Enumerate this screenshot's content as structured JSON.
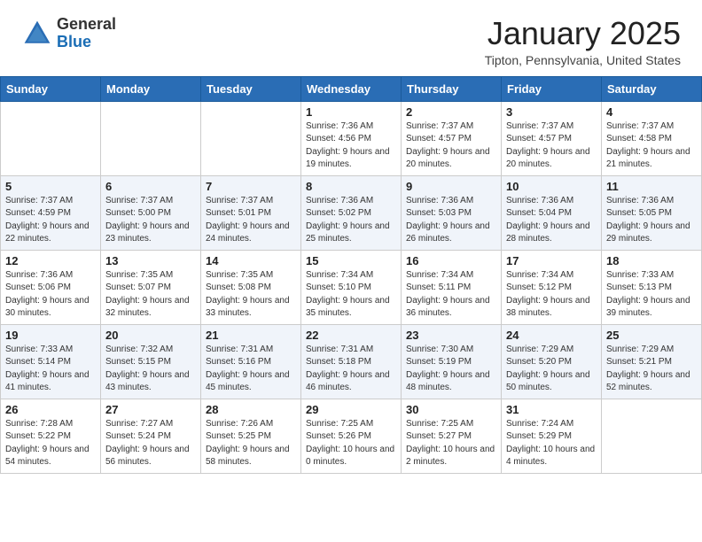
{
  "header": {
    "logo_general": "General",
    "logo_blue": "Blue",
    "month_title": "January 2025",
    "location": "Tipton, Pennsylvania, United States"
  },
  "days_of_week": [
    "Sunday",
    "Monday",
    "Tuesday",
    "Wednesday",
    "Thursday",
    "Friday",
    "Saturday"
  ],
  "weeks": [
    [
      {
        "day": "",
        "sunrise": "",
        "sunset": "",
        "daylight": ""
      },
      {
        "day": "",
        "sunrise": "",
        "sunset": "",
        "daylight": ""
      },
      {
        "day": "",
        "sunrise": "",
        "sunset": "",
        "daylight": ""
      },
      {
        "day": "1",
        "sunrise": "Sunrise: 7:36 AM",
        "sunset": "Sunset: 4:56 PM",
        "daylight": "Daylight: 9 hours and 19 minutes."
      },
      {
        "day": "2",
        "sunrise": "Sunrise: 7:37 AM",
        "sunset": "Sunset: 4:57 PM",
        "daylight": "Daylight: 9 hours and 20 minutes."
      },
      {
        "day": "3",
        "sunrise": "Sunrise: 7:37 AM",
        "sunset": "Sunset: 4:57 PM",
        "daylight": "Daylight: 9 hours and 20 minutes."
      },
      {
        "day": "4",
        "sunrise": "Sunrise: 7:37 AM",
        "sunset": "Sunset: 4:58 PM",
        "daylight": "Daylight: 9 hours and 21 minutes."
      }
    ],
    [
      {
        "day": "5",
        "sunrise": "Sunrise: 7:37 AM",
        "sunset": "Sunset: 4:59 PM",
        "daylight": "Daylight: 9 hours and 22 minutes."
      },
      {
        "day": "6",
        "sunrise": "Sunrise: 7:37 AM",
        "sunset": "Sunset: 5:00 PM",
        "daylight": "Daylight: 9 hours and 23 minutes."
      },
      {
        "day": "7",
        "sunrise": "Sunrise: 7:37 AM",
        "sunset": "Sunset: 5:01 PM",
        "daylight": "Daylight: 9 hours and 24 minutes."
      },
      {
        "day": "8",
        "sunrise": "Sunrise: 7:36 AM",
        "sunset": "Sunset: 5:02 PM",
        "daylight": "Daylight: 9 hours and 25 minutes."
      },
      {
        "day": "9",
        "sunrise": "Sunrise: 7:36 AM",
        "sunset": "Sunset: 5:03 PM",
        "daylight": "Daylight: 9 hours and 26 minutes."
      },
      {
        "day": "10",
        "sunrise": "Sunrise: 7:36 AM",
        "sunset": "Sunset: 5:04 PM",
        "daylight": "Daylight: 9 hours and 28 minutes."
      },
      {
        "day": "11",
        "sunrise": "Sunrise: 7:36 AM",
        "sunset": "Sunset: 5:05 PM",
        "daylight": "Daylight: 9 hours and 29 minutes."
      }
    ],
    [
      {
        "day": "12",
        "sunrise": "Sunrise: 7:36 AM",
        "sunset": "Sunset: 5:06 PM",
        "daylight": "Daylight: 9 hours and 30 minutes."
      },
      {
        "day": "13",
        "sunrise": "Sunrise: 7:35 AM",
        "sunset": "Sunset: 5:07 PM",
        "daylight": "Daylight: 9 hours and 32 minutes."
      },
      {
        "day": "14",
        "sunrise": "Sunrise: 7:35 AM",
        "sunset": "Sunset: 5:08 PM",
        "daylight": "Daylight: 9 hours and 33 minutes."
      },
      {
        "day": "15",
        "sunrise": "Sunrise: 7:34 AM",
        "sunset": "Sunset: 5:10 PM",
        "daylight": "Daylight: 9 hours and 35 minutes."
      },
      {
        "day": "16",
        "sunrise": "Sunrise: 7:34 AM",
        "sunset": "Sunset: 5:11 PM",
        "daylight": "Daylight: 9 hours and 36 minutes."
      },
      {
        "day": "17",
        "sunrise": "Sunrise: 7:34 AM",
        "sunset": "Sunset: 5:12 PM",
        "daylight": "Daylight: 9 hours and 38 minutes."
      },
      {
        "day": "18",
        "sunrise": "Sunrise: 7:33 AM",
        "sunset": "Sunset: 5:13 PM",
        "daylight": "Daylight: 9 hours and 39 minutes."
      }
    ],
    [
      {
        "day": "19",
        "sunrise": "Sunrise: 7:33 AM",
        "sunset": "Sunset: 5:14 PM",
        "daylight": "Daylight: 9 hours and 41 minutes."
      },
      {
        "day": "20",
        "sunrise": "Sunrise: 7:32 AM",
        "sunset": "Sunset: 5:15 PM",
        "daylight": "Daylight: 9 hours and 43 minutes."
      },
      {
        "day": "21",
        "sunrise": "Sunrise: 7:31 AM",
        "sunset": "Sunset: 5:16 PM",
        "daylight": "Daylight: 9 hours and 45 minutes."
      },
      {
        "day": "22",
        "sunrise": "Sunrise: 7:31 AM",
        "sunset": "Sunset: 5:18 PM",
        "daylight": "Daylight: 9 hours and 46 minutes."
      },
      {
        "day": "23",
        "sunrise": "Sunrise: 7:30 AM",
        "sunset": "Sunset: 5:19 PM",
        "daylight": "Daylight: 9 hours and 48 minutes."
      },
      {
        "day": "24",
        "sunrise": "Sunrise: 7:29 AM",
        "sunset": "Sunset: 5:20 PM",
        "daylight": "Daylight: 9 hours and 50 minutes."
      },
      {
        "day": "25",
        "sunrise": "Sunrise: 7:29 AM",
        "sunset": "Sunset: 5:21 PM",
        "daylight": "Daylight: 9 hours and 52 minutes."
      }
    ],
    [
      {
        "day": "26",
        "sunrise": "Sunrise: 7:28 AM",
        "sunset": "Sunset: 5:22 PM",
        "daylight": "Daylight: 9 hours and 54 minutes."
      },
      {
        "day": "27",
        "sunrise": "Sunrise: 7:27 AM",
        "sunset": "Sunset: 5:24 PM",
        "daylight": "Daylight: 9 hours and 56 minutes."
      },
      {
        "day": "28",
        "sunrise": "Sunrise: 7:26 AM",
        "sunset": "Sunset: 5:25 PM",
        "daylight": "Daylight: 9 hours and 58 minutes."
      },
      {
        "day": "29",
        "sunrise": "Sunrise: 7:25 AM",
        "sunset": "Sunset: 5:26 PM",
        "daylight": "Daylight: 10 hours and 0 minutes."
      },
      {
        "day": "30",
        "sunrise": "Sunrise: 7:25 AM",
        "sunset": "Sunset: 5:27 PM",
        "daylight": "Daylight: 10 hours and 2 minutes."
      },
      {
        "day": "31",
        "sunrise": "Sunrise: 7:24 AM",
        "sunset": "Sunset: 5:29 PM",
        "daylight": "Daylight: 10 hours and 4 minutes."
      },
      {
        "day": "",
        "sunrise": "",
        "sunset": "",
        "daylight": ""
      }
    ]
  ]
}
